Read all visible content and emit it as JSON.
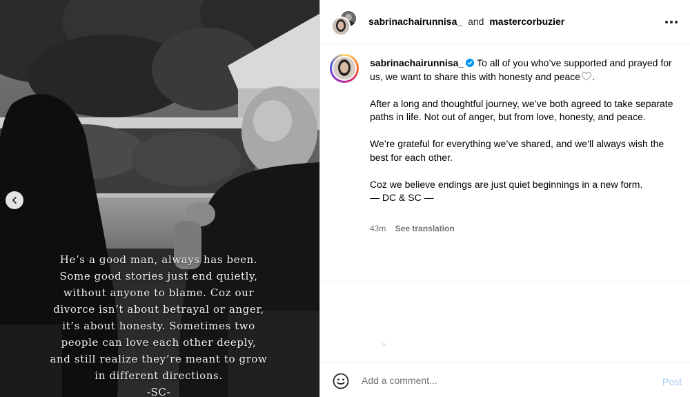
{
  "header": {
    "user1": "sabrinachairunnisa_",
    "conjunction": "and",
    "user2": "mastercorbuzier",
    "more_icon": "more-horizontal-icon"
  },
  "caption": {
    "username": "sabrinachairunnisa_",
    "verified_icon": "verified-badge-icon",
    "intro": "To all of you who’ve supported and prayed for us, we want to share this with honesty and peace",
    "intro_end": ".",
    "heart_icon": "heart-outline-icon",
    "paragraph2": "After a long and thoughtful journey, we’ve both agreed to take separate paths in life. Not out of anger, but from love, honesty, and peace.",
    "paragraph3": "We’re grateful for everything we’ve shared, and we’ll always wish the best for each other.",
    "paragraph4_line1": "Coz we believe endings are just quiet beginnings in a new form.",
    "paragraph4_line2": "— DC & SC —"
  },
  "meta": {
    "time": "43m",
    "see_translation": "See translation"
  },
  "media": {
    "prev_icon": "chevron-left-icon",
    "overlay_lines": [
      "He’s a good man, always has been.",
      "Some good stories just end quietly,",
      "without anyone to blame. Coz our",
      "divorce isn’t about betrayal or anger,",
      "it’s about honesty. Sometimes two",
      "people can love each other deeply,",
      "and still realize they’re meant to grow",
      "in different directions.",
      "-SC-"
    ]
  },
  "comment": {
    "emoji_icon": "emoji-smile-icon",
    "placeholder": "Add a comment...",
    "post_label": "Post"
  },
  "colors": {
    "verified": "#0095f6",
    "post_disabled": "#a6c8f5",
    "muted_text": "#737373"
  }
}
